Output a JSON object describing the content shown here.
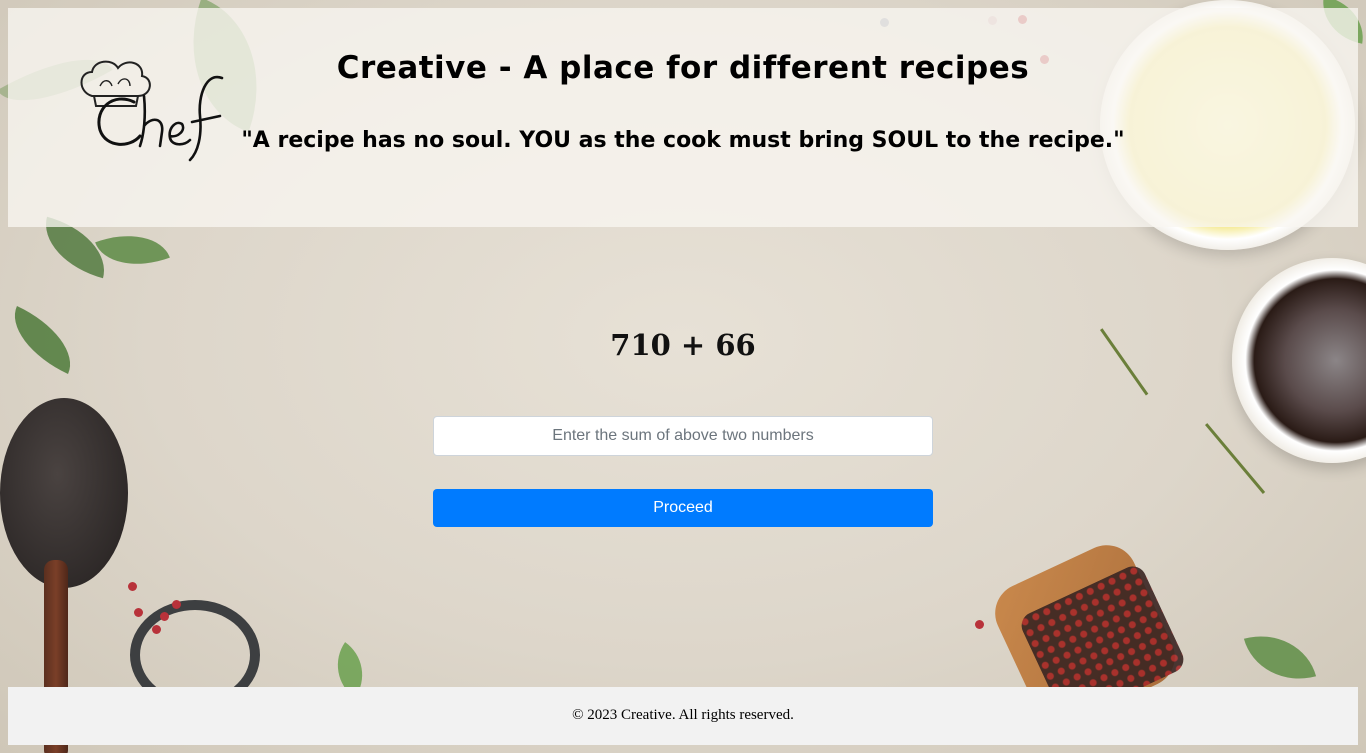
{
  "header": {
    "logo_text": "Chef",
    "title": "Creative - A place for different recipes",
    "quote": "\"A recipe has no soul. YOU as the cook must bring SOUL to the recipe.\""
  },
  "challenge": {
    "expression": "710 + 66",
    "input_placeholder": "Enter the sum of above two numbers",
    "input_value": "",
    "button_label": "Proceed"
  },
  "footer": {
    "copyright": "© 2023 Creative. All rights reserved."
  },
  "colors": {
    "accent": "#007bff",
    "footer_bg": "#f2f2f2"
  },
  "icons": {
    "logo": "chef-hat-icon"
  }
}
